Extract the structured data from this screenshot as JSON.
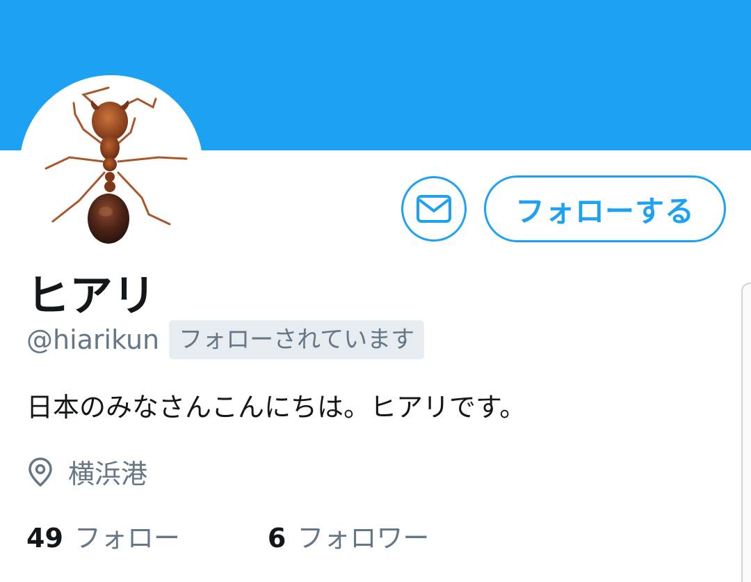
{
  "profile": {
    "display_name": "ヒアリ",
    "handle": "@hiarikun",
    "follows_you_badge": "フォローされています",
    "bio": "日本のみなさんこんにちは。ヒアリです。",
    "location": "横浜港"
  },
  "actions": {
    "message_icon": "envelope-icon",
    "follow_label": "フォローする"
  },
  "stats": {
    "following_count": "49",
    "following_label": "フォロー",
    "followers_count": "6",
    "followers_label": "フォロワー"
  },
  "colors": {
    "accent": "#1da1f2",
    "secondary_text": "#657786",
    "badge_bg": "#e6ecf0",
    "primary_text": "#14171a"
  },
  "icons": {
    "location": "location-pin-icon",
    "avatar": "fire-ant-avatar"
  }
}
